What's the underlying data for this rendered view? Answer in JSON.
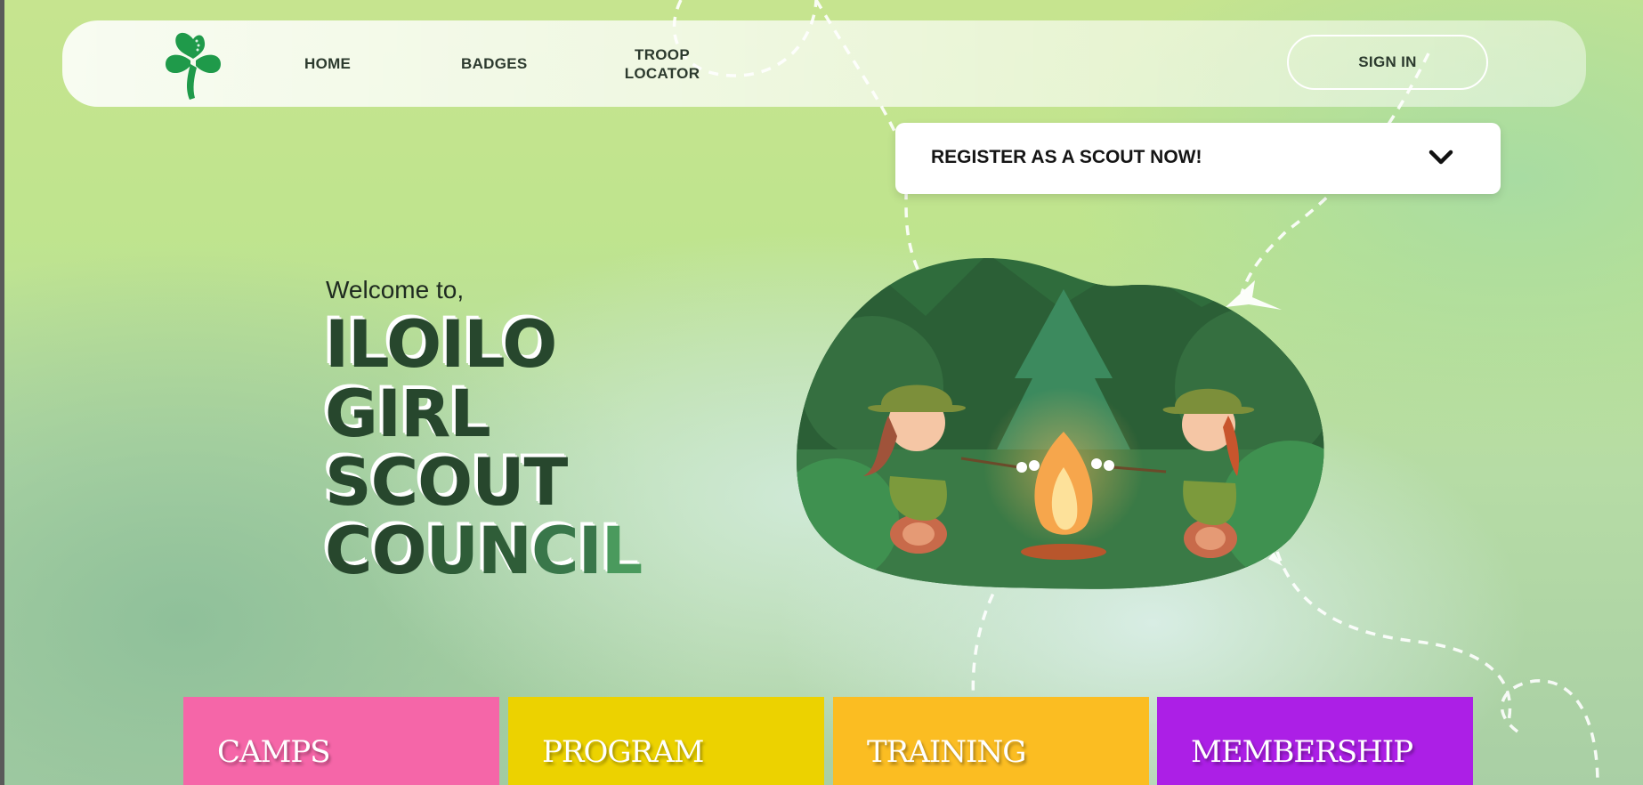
{
  "nav": {
    "logo_icon": "trefoil-logo-icon",
    "links": [
      "HOME",
      "BADGES",
      "TROOP",
      "LOCATOR"
    ],
    "sign_in": "SIGN IN"
  },
  "register": {
    "label": "REGISTER AS A SCOUT NOW!",
    "icon": "chevron-down-icon"
  },
  "hero": {
    "welcome": "Welcome to,",
    "line1": "ILOILO",
    "line2": "GIRL",
    "line3": "SCOUT",
    "line4_parts": [
      "CO",
      "UN",
      "CI",
      "L"
    ]
  },
  "illustration": {
    "icon": "campfire-scouts-illustration"
  },
  "cards": [
    {
      "label": "CAMPS",
      "color": "#f566a8"
    },
    {
      "label": "PROGRAM",
      "color": "#ecd200"
    },
    {
      "label": "TRAINING",
      "color": "#fbbd22"
    },
    {
      "label": "MEMBERSHIP",
      "color": "#ac1fe6"
    }
  ],
  "colors": {
    "accent_dark_green": "#27472d",
    "logo_green": "#1f9a4a"
  }
}
